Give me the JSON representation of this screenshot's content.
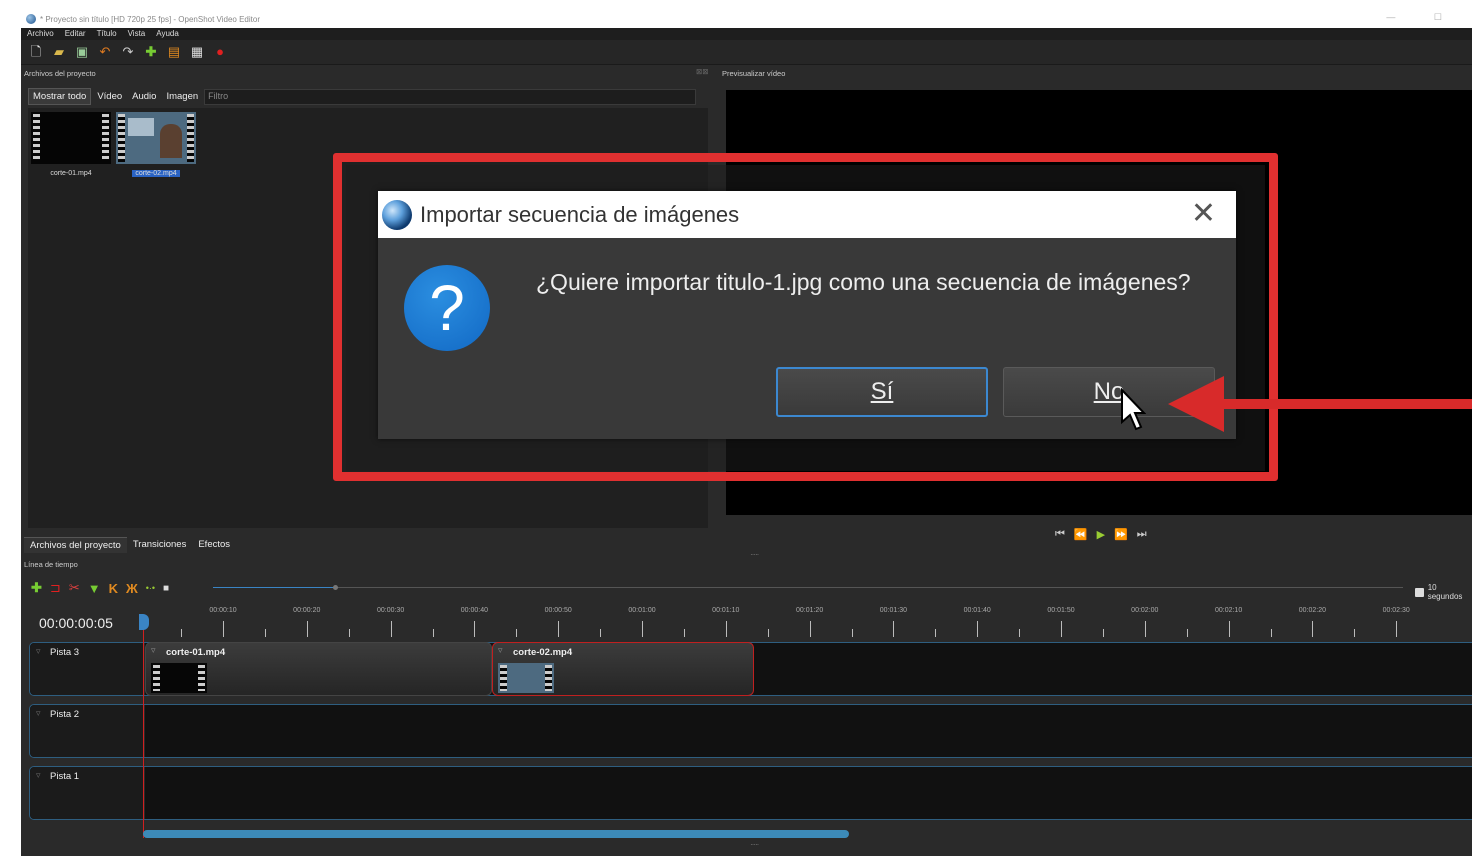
{
  "window": {
    "title": "* Proyecto sin título [HD 720p 25 fps] - OpenShot Video Editor",
    "controls": "— ☐"
  },
  "menu": [
    "Archivo",
    "Editar",
    "Título",
    "Vista",
    "Ayuda"
  ],
  "toolbar_icons": [
    "new-file-icon",
    "open-folder-icon",
    "save-icon",
    "undo-icon",
    "redo-icon",
    "import-files-icon",
    "choose-profile-icon",
    "fullscreen-icon",
    "export-video-icon"
  ],
  "project_files": {
    "panel_title": "Archivos del proyecto",
    "filter_tabs": [
      "Mostrar todo",
      "Vídeo",
      "Audio",
      "Imagen"
    ],
    "filter_placeholder": "Filtro",
    "files": [
      {
        "name": "corte-01.mp4",
        "selected": false
      },
      {
        "name": "corte-02.mp4",
        "selected": true
      }
    ]
  },
  "preview": {
    "panel_title": "Previsualizar vídeo",
    "transport": [
      "⏮",
      "⏪",
      "▶",
      "⏩",
      "⏭"
    ]
  },
  "bottom_tabs": [
    "Archivos del proyecto",
    "Transiciones",
    "Efectos"
  ],
  "timeline": {
    "panel_title": "Línea de tiempo",
    "timecode": "00:00:00:05",
    "zoom_label": "10 segundos",
    "ruler_labels": [
      "00:00:10",
      "00:00:20",
      "00:00:30",
      "00:00:40",
      "00:00:50",
      "00:01:00",
      "00:01:10",
      "00:01:20",
      "00:01:30",
      "00:01:40",
      "00:01:50",
      "00:02:00",
      "00:02:10",
      "00:02:20",
      "00:02:30"
    ],
    "tracks": [
      {
        "name": "Pista 3",
        "clips": [
          {
            "name": "corte-01.mp4",
            "selected": false
          },
          {
            "name": "corte-02.mp4",
            "selected": true
          }
        ]
      },
      {
        "name": "Pista 2",
        "clips": []
      },
      {
        "name": "Pista 1",
        "clips": []
      }
    ],
    "scroll_fraction": 0.49
  },
  "dialog": {
    "title": "Importar secuencia de imágenes",
    "message": "¿Quiere importar titulo-1.jpg como una secuencia de imágenes?",
    "yes_label": "Sí",
    "no_label": "No",
    "icon": "question-icon",
    "close_glyph": "✕"
  },
  "annotation_color": "#e03030",
  "accent_color": "#3a84c4"
}
